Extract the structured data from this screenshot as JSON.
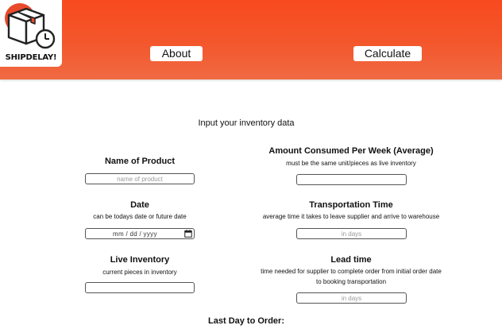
{
  "header": {
    "logo_text": "SHIPDELAY!",
    "nav": {
      "about_label": "About",
      "calculate_label": "Calculate"
    }
  },
  "form": {
    "title": "Input your inventory data",
    "product_name": {
      "label": "Name of Product",
      "placeholder": "name of product"
    },
    "date": {
      "label": "Date",
      "hint": "can be todays date or future date",
      "value": "mm / dd / yyyy"
    },
    "live_inventory": {
      "label": "Live Inventory",
      "hint": "current pieces in inventory",
      "placeholder": ""
    },
    "amount_consumed": {
      "label": "Amount Consumed Per Week (Average)",
      "hint": "must be the same unit/pieces as live inventory",
      "placeholder": ""
    },
    "transportation_time": {
      "label": "Transportation Time",
      "hint": "average time it takes to leave supplier and arrive to warehouse",
      "placeholder": "in days"
    },
    "lead_time": {
      "label": "Lead time",
      "hint_line1": "time needed for supplier to complete order from initial order date",
      "hint_line2": "to booking transportation",
      "placeholder": "in days"
    }
  },
  "result": {
    "label": "Last Day to Order:"
  },
  "colors": {
    "header_top": "#f84a1f",
    "header_bottom": "#f06a43",
    "background": "#ffffff"
  }
}
